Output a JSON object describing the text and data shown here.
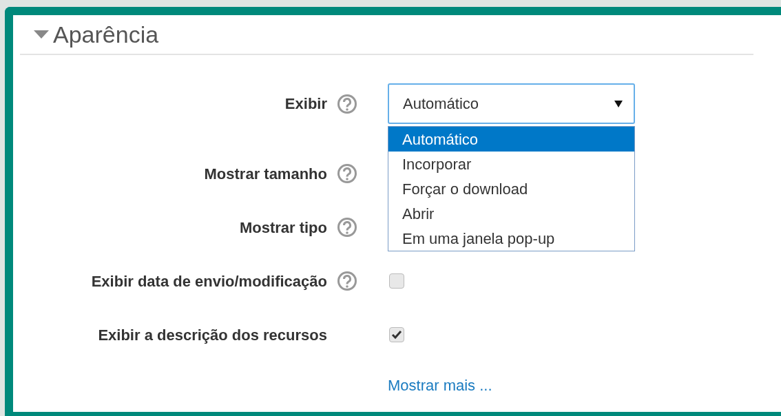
{
  "section": {
    "title": "Aparência",
    "expanded": true
  },
  "fields": [
    {
      "label": "Exibir",
      "help": true,
      "kind": "select",
      "value": "Automático",
      "open": true,
      "options": [
        {
          "label": "Automático",
          "selected": true
        },
        {
          "label": "Incorporar",
          "selected": false
        },
        {
          "label": "Forçar o download",
          "selected": false
        },
        {
          "label": "Abrir",
          "selected": false
        },
        {
          "label": "Em uma janela pop-up",
          "selected": false
        }
      ]
    },
    {
      "label": "Mostrar tamanho",
      "help": true,
      "kind": "covered"
    },
    {
      "label": "Mostrar tipo",
      "help": true,
      "kind": "covered"
    },
    {
      "label": "Exibir data de envio/modificação",
      "help": true,
      "kind": "checkbox",
      "checked": false
    },
    {
      "label": "Exibir a descrição dos recursos",
      "help": false,
      "kind": "checkbox",
      "checked": true
    }
  ],
  "more_link": "Mostrar mais ..."
}
